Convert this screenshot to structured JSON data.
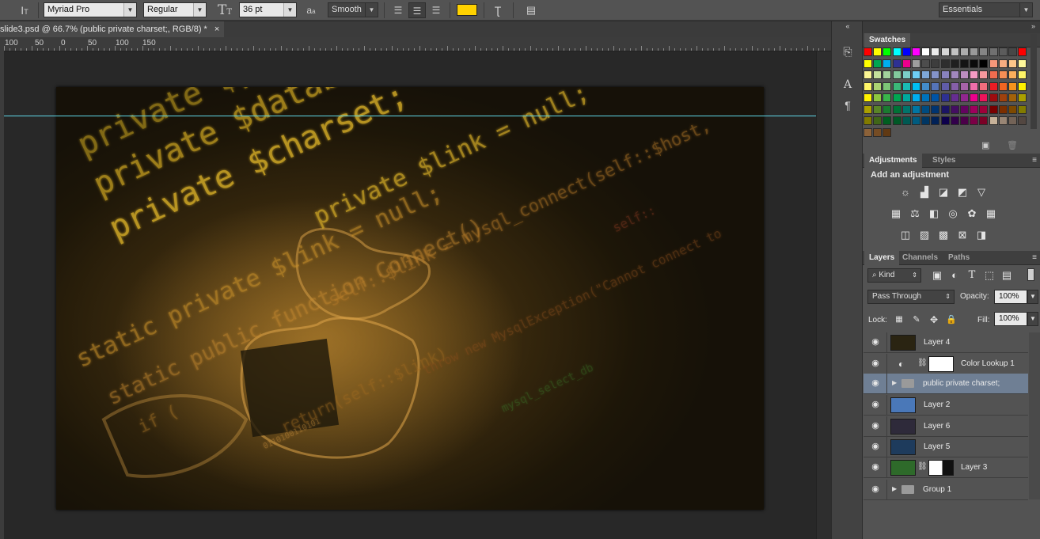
{
  "options_bar": {
    "font_family": "Myriad Pro",
    "font_style": "Regular",
    "font_size": "36 pt",
    "aa_label": "a",
    "antialias": "Smooth",
    "text_color": "#ffd200",
    "workspace": "Essentials"
  },
  "document": {
    "tab_title": "slide3.psd @ 66.7% (public private charset;, RGB/8) *",
    "close_glyph": "×"
  },
  "ruler": {
    "labels": [
      "100",
      "50",
      "0",
      "50",
      "100",
      "150"
    ]
  },
  "artwork": {
    "lines": [
      "private $pas",
      "private $databa",
      "private $charset;",
      "private $link = null;",
      "static private $link = null;",
      "static public function Connect()",
      "self::$link = mysql_connect(self::$host,",
      "return(self::$link)",
      "throw new MysqlException(\"Cannot connect to",
      "self::",
      "mysql_select_db",
      "0110100110101",
      "if ("
    ]
  },
  "swatches": {
    "title": "Swatches",
    "colors": [
      [
        "#ff0000",
        "#ffff00",
        "#00ff00",
        "#00ffff",
        "#0000ff",
        "#ff00ff",
        "#ffffff",
        "#ebebeb",
        "#d6d6d6",
        "#c2c2c2",
        "#adadad",
        "#999999",
        "#858585",
        "#707070",
        "#5c5c5c",
        "#474747",
        "#ff0000"
      ],
      [
        "#ffff00",
        "#00a651",
        "#00aeef",
        "#2e3192",
        "#ec008c",
        "#9e9e9e",
        "#4d4d4d",
        "#3d3d3d",
        "#2e2e2e",
        "#1f1f1f",
        "#141414",
        "#0a0a0a",
        "#000000",
        "#f7977a",
        "#f9ad81",
        "#fdc68a",
        "#fff79a"
      ],
      [
        "#fbf593",
        "#c4df9b",
        "#a2d39c",
        "#82ca9d",
        "#7bcdc8",
        "#6ecff6",
        "#7ea7d8",
        "#8493ca",
        "#8882be",
        "#a187be",
        "#bc8dbf",
        "#f49ac2",
        "#f6989d",
        "#f26c4f",
        "#f68e55",
        "#fbaf5c",
        "#fff467"
      ],
      [
        "#fff568",
        "#acd372",
        "#7cc576",
        "#3bb878",
        "#1abbb4",
        "#00bff3",
        "#438ccb",
        "#5574b9",
        "#605ca8",
        "#855fa8",
        "#a763a8",
        "#f06eaa",
        "#f26d7d",
        "#ed1c24",
        "#f26522",
        "#f7941d",
        "#fff200"
      ],
      [
        "#fff200",
        "#8dc63f",
        "#39b54a",
        "#00a651",
        "#00a99d",
        "#00aeef",
        "#0072bc",
        "#0054a6",
        "#2e3192",
        "#662d91",
        "#92278f",
        "#ec008c",
        "#ed145b",
        "#9e0b0f",
        "#a0410d",
        "#a36209",
        "#aba000"
      ],
      [
        "#aba000",
        "#598527",
        "#1a7b30",
        "#007236",
        "#00746b",
        "#0076a3",
        "#004b80",
        "#003471",
        "#1b1464",
        "#440e62",
        "#630460",
        "#9e005d",
        "#9e0039",
        "#790000",
        "#7b2e00",
        "#7d4900",
        "#827b00"
      ],
      [
        "#827b00",
        "#406618",
        "#005e20",
        "#005826",
        "#005952",
        "#005b7f",
        "#003663",
        "#002157",
        "#0d004c",
        "#32004b",
        "#4b0049",
        "#7b0046",
        "#7a0026",
        "#c7b299",
        "#998675",
        "#736357",
        "#534741"
      ],
      [
        "#8c6239",
        "#754c24",
        "#603913"
      ]
    ]
  },
  "adjustments": {
    "tab_active": "Adjustments",
    "tab_other": "Styles",
    "heading": "Add an adjustment"
  },
  "layers_panel": {
    "tabs": [
      "Layers",
      "Channels",
      "Paths"
    ],
    "filter_kind": "Kind",
    "blend_mode": "Pass Through",
    "opacity_label": "Opacity:",
    "opacity_value": "100%",
    "lock_label": "Lock:",
    "fill_label": "Fill:",
    "fill_value": "100%",
    "layers": [
      {
        "name": "Layer 4",
        "thumb_color": "#2a2412",
        "type": "pixel",
        "selected": false
      },
      {
        "name": "Color Lookup 1",
        "thumb_color": "#ffffff",
        "type": "adjustment",
        "selected": false
      },
      {
        "name": "public private charset;",
        "thumb_color": "#9a9a9a",
        "type": "group",
        "selected": true
      },
      {
        "name": "Layer 2",
        "thumb_color": "#4a78b8",
        "type": "pixel",
        "selected": false
      },
      {
        "name": "Layer 6",
        "thumb_color": "#2e2a3a",
        "type": "pixel",
        "selected": false
      },
      {
        "name": "Layer 5",
        "thumb_color": "#1e3b5c",
        "type": "pixel",
        "selected": false
      },
      {
        "name": "Layer 3",
        "thumb_color": "#2e6a2a",
        "type": "masked",
        "selected": false
      },
      {
        "name": "Group 1",
        "thumb_color": "#9a9a9a",
        "type": "group",
        "selected": false
      }
    ]
  }
}
